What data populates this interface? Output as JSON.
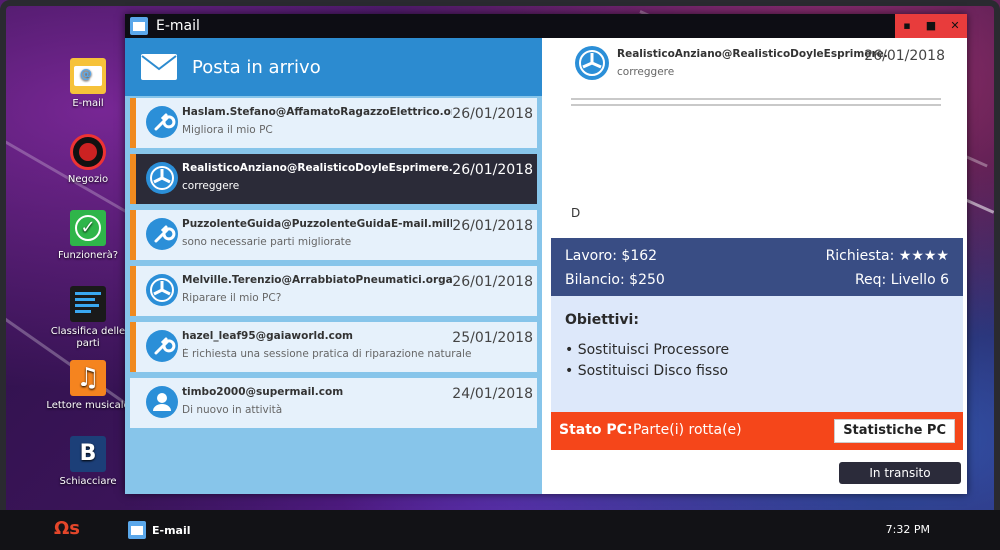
{
  "desktop": {
    "icons": [
      {
        "label": "E-mail",
        "icon": "email-icon"
      },
      {
        "label": "Negozio",
        "icon": "fan-shop-icon"
      },
      {
        "label": "Funzionerà?",
        "icon": "check-icon"
      },
      {
        "label": "Classifica delle parti",
        "icon": "ranking-icon"
      },
      {
        "label": "Lettore musicale",
        "icon": "music-icon"
      },
      {
        "label": "Schiacciare",
        "icon": "crush-b-icon"
      }
    ]
  },
  "window": {
    "title": "E-mail",
    "controls": {
      "minimize": "▪",
      "maximize": "■",
      "close": "✕"
    }
  },
  "inbox": {
    "header": "Posta in arrivo",
    "items": [
      {
        "sender": "Haslam.Stefano@AffamatoRagazzoElettrico.organi",
        "subject": "Migliora il mio PC",
        "date": "26/01/2018",
        "icon": "wrench-icon",
        "accent": true,
        "selected": false
      },
      {
        "sender": "RealisticoAnziano@RealisticoDoyleEsprimere.televis",
        "subject": "correggere",
        "date": "26/01/2018",
        "icon": "fan-icon",
        "accent": true,
        "selected": true
      },
      {
        "sender": "PuzzolenteGuida@PuzzolenteGuidaE-mail.mille",
        "subject": "sono necessarie parti migliorate",
        "date": "26/01/2018",
        "icon": "wrench-icon",
        "accent": true,
        "selected": false
      },
      {
        "sender": "Melville.Terenzio@ArrabbiatoPneumatici.organizza",
        "subject": "Riparare il mio PC?",
        "date": "26/01/2018",
        "icon": "fan-icon",
        "accent": true,
        "selected": false
      },
      {
        "sender": "hazel_leaf95@gaiaworld.com",
        "subject": "È richiesta una sessione pratica di riparazione naturale",
        "date": "25/01/2018",
        "icon": "wrench-icon",
        "accent": true,
        "selected": false
      },
      {
        "sender": "timbo2000@supermail.com",
        "subject": "Di nuovo in attività",
        "date": "24/01/2018",
        "icon": "person-icon",
        "accent": false,
        "selected": false
      }
    ]
  },
  "detail": {
    "sender": "RealisticoAnziano@RealisticoDoyleEsprimere.",
    "subject": "correggere",
    "date": "26/01/2018",
    "body": "D",
    "job": {
      "work": "Lavoro: $162",
      "request": "Richiesta: ★★★★",
      "budget": "Bilancio: $250",
      "req_level": "Req: Livello 6"
    },
    "objectives": {
      "header": "Obiettivi:",
      "items": [
        "• Sostituisci Processore",
        "• Sostituisci Disco fisso"
      ]
    },
    "status": {
      "label": "Stato PC:",
      "value": "Parte(i) rotta(e)",
      "stats_button": "Statistiche PC"
    },
    "transit_button": "In transito"
  },
  "taskbar": {
    "start_label": "Ωs",
    "task_label": "E-mail",
    "clock": "7:32 PM"
  },
  "colors": {
    "accent_orange": "#f08a1f",
    "inbox_blue": "#2c8bd0",
    "job_panel": "#394d84",
    "status_red": "#f5461a"
  }
}
